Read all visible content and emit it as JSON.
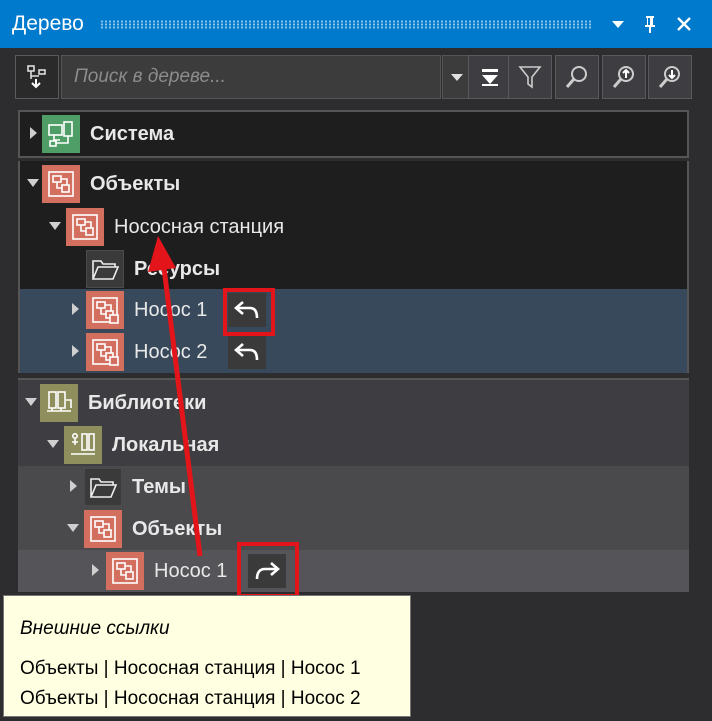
{
  "window": {
    "title": "Дерево"
  },
  "toolbar": {
    "search_placeholder": "Поиск в дереве..."
  },
  "tree": {
    "system": {
      "label": "Система"
    },
    "objects": {
      "label": "Объекты",
      "station": {
        "label": "Нососная станция"
      },
      "resources": {
        "label": "Ресурсы"
      },
      "pumps": [
        {
          "label": "Нocoс 1"
        },
        {
          "label": "Нocoс 2"
        }
      ]
    },
    "libraries": {
      "label": "Библиотеки",
      "local": {
        "label": "Локальная"
      },
      "themes": {
        "label": "Темы"
      },
      "objects": {
        "label": "Объекты"
      },
      "pump": {
        "label": "Нocoс 1"
      }
    }
  },
  "tooltip": {
    "title": "Внешние ссылки",
    "lines": [
      "Объекты | Нососная станция | Нocoс 1",
      "Объекты | Нососная станция | Нocoс 2"
    ]
  },
  "colors": {
    "title_bar": "#007acc",
    "annotation": "#e3151a",
    "selected_row": "#37495a",
    "tooltip_bg": "#ffffe1"
  }
}
